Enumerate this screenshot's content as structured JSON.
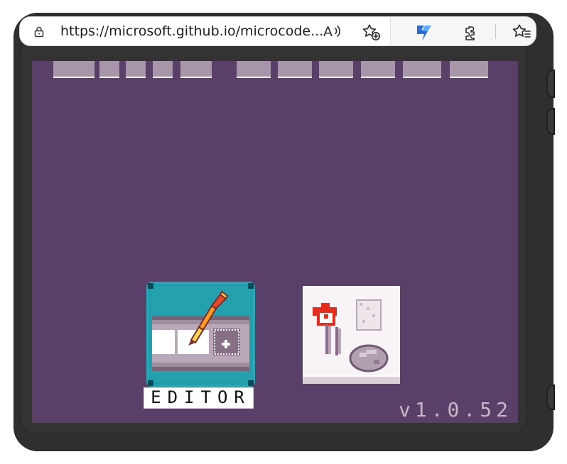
{
  "browser": {
    "url": "https://microsoft.github.io/microcode...",
    "address_placeholder": "",
    "read_aloud_title": "Read aloud",
    "favorites_add_title": "Add this page to favorites",
    "copilot_title": "Copilot",
    "extensions_title": "Extensions",
    "favorites_title": "Favorites"
  },
  "game": {
    "background_color": "#5a3f68",
    "accent_teal": "#3bb8c7",
    "editor_label": "EDITOR",
    "version_label": "v1.0.52"
  },
  "icons": {
    "lock": "lock-icon",
    "read_aloud": "read-aloud-icon",
    "favorite_add": "favorite-add-icon",
    "copilot": "copilot-icon",
    "extensions": "puzzle-icon",
    "favorites": "favorites-icon",
    "editor": "pencil-edit-icon",
    "samples": "samples-icon"
  }
}
